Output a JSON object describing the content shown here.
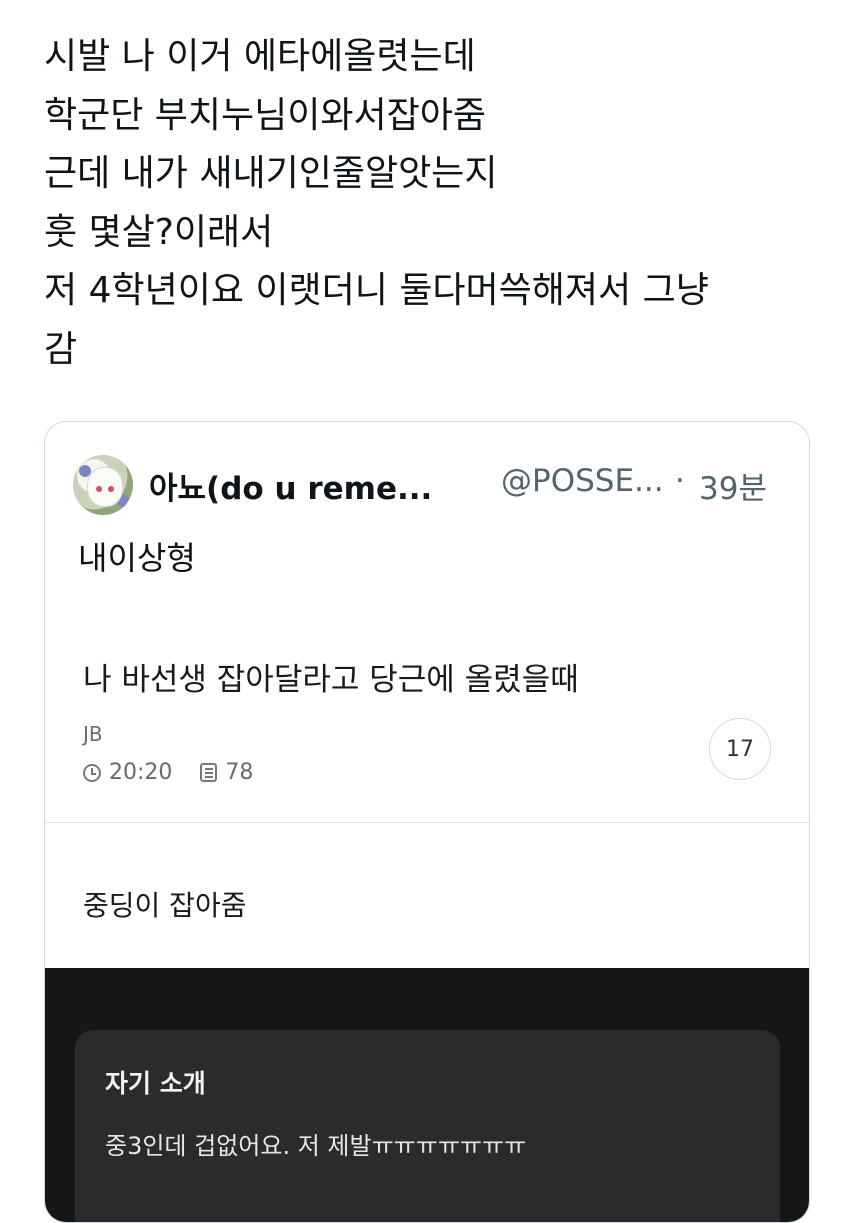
{
  "post": {
    "lines": [
      "시발 나 이거 에타에올렷는데",
      "학군단 부치누님이와서잡아줌",
      "근데 내가 새내기인줄알앗는지",
      "훗 몇살?이래서",
      "저 4학년이요 이랫더니 둘다머쓱해져서 그냥",
      "감"
    ]
  },
  "quote": {
    "display_name": "아뇨(do u reme...",
    "handle": "@POSSE...",
    "dot": "·",
    "time": "39분",
    "text": "내이상형",
    "screenshot": {
      "title": "나 바선생 잡아달라고 당근에 올렸을때",
      "region": "JB",
      "time": "20:20",
      "views": "78",
      "chat_count": "17",
      "caption": "중딩이 잡아줌",
      "intro_title": "자기 소개",
      "intro_text": "중3인데 겁없어요. 저 제발ㅠㅠㅠㅠㅠㅠㅠ"
    }
  },
  "icons": {
    "avatar": "avatar-illustration",
    "clock": "clock-icon",
    "views": "list-icon"
  },
  "colors": {
    "text": "#0f1419",
    "secondary": "#536471",
    "border": "#cfd9de",
    "dark_panel": "#161616",
    "intro_card": "#2b2b2b"
  }
}
